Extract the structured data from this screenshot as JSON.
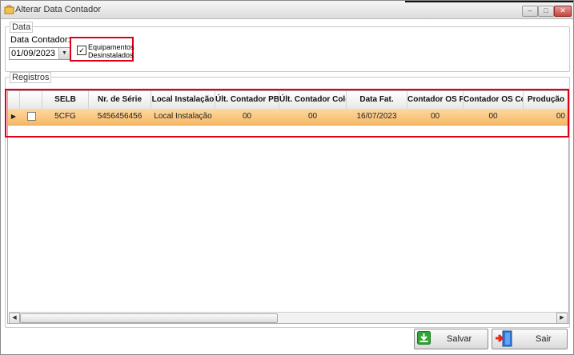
{
  "window": {
    "title": "Alterar Data Contador"
  },
  "data_group": {
    "legend": "Data",
    "label": "Data Contador:",
    "date_value": "01/09/2023",
    "checkbox_label_line1": "Equipamentos",
    "checkbox_label_line2": "Desinstalados",
    "checkbox_checked": true
  },
  "registros_group": {
    "legend": "Registros"
  },
  "grid": {
    "columns": [
      "SELB",
      "Nr. de Série",
      "Local Instalação",
      "Últ. Contador PB",
      "Últ. Contador Color",
      "Data Fat.",
      "Contador OS PB",
      "Contador OS Color",
      "Produção"
    ],
    "rows": [
      {
        "selected": true,
        "checked": false,
        "cells": [
          "5CFG",
          "5456456456",
          "Local Instalação",
          "00",
          "00",
          "16/07/2023",
          "00",
          "00",
          "00"
        ]
      }
    ]
  },
  "buttons": {
    "save_label": "Salvar",
    "exit_label": "Sair"
  },
  "colors": {
    "selected_row": "#f8c47c",
    "highlight_border": "#e0001a",
    "save_icon": "#2fa534"
  }
}
